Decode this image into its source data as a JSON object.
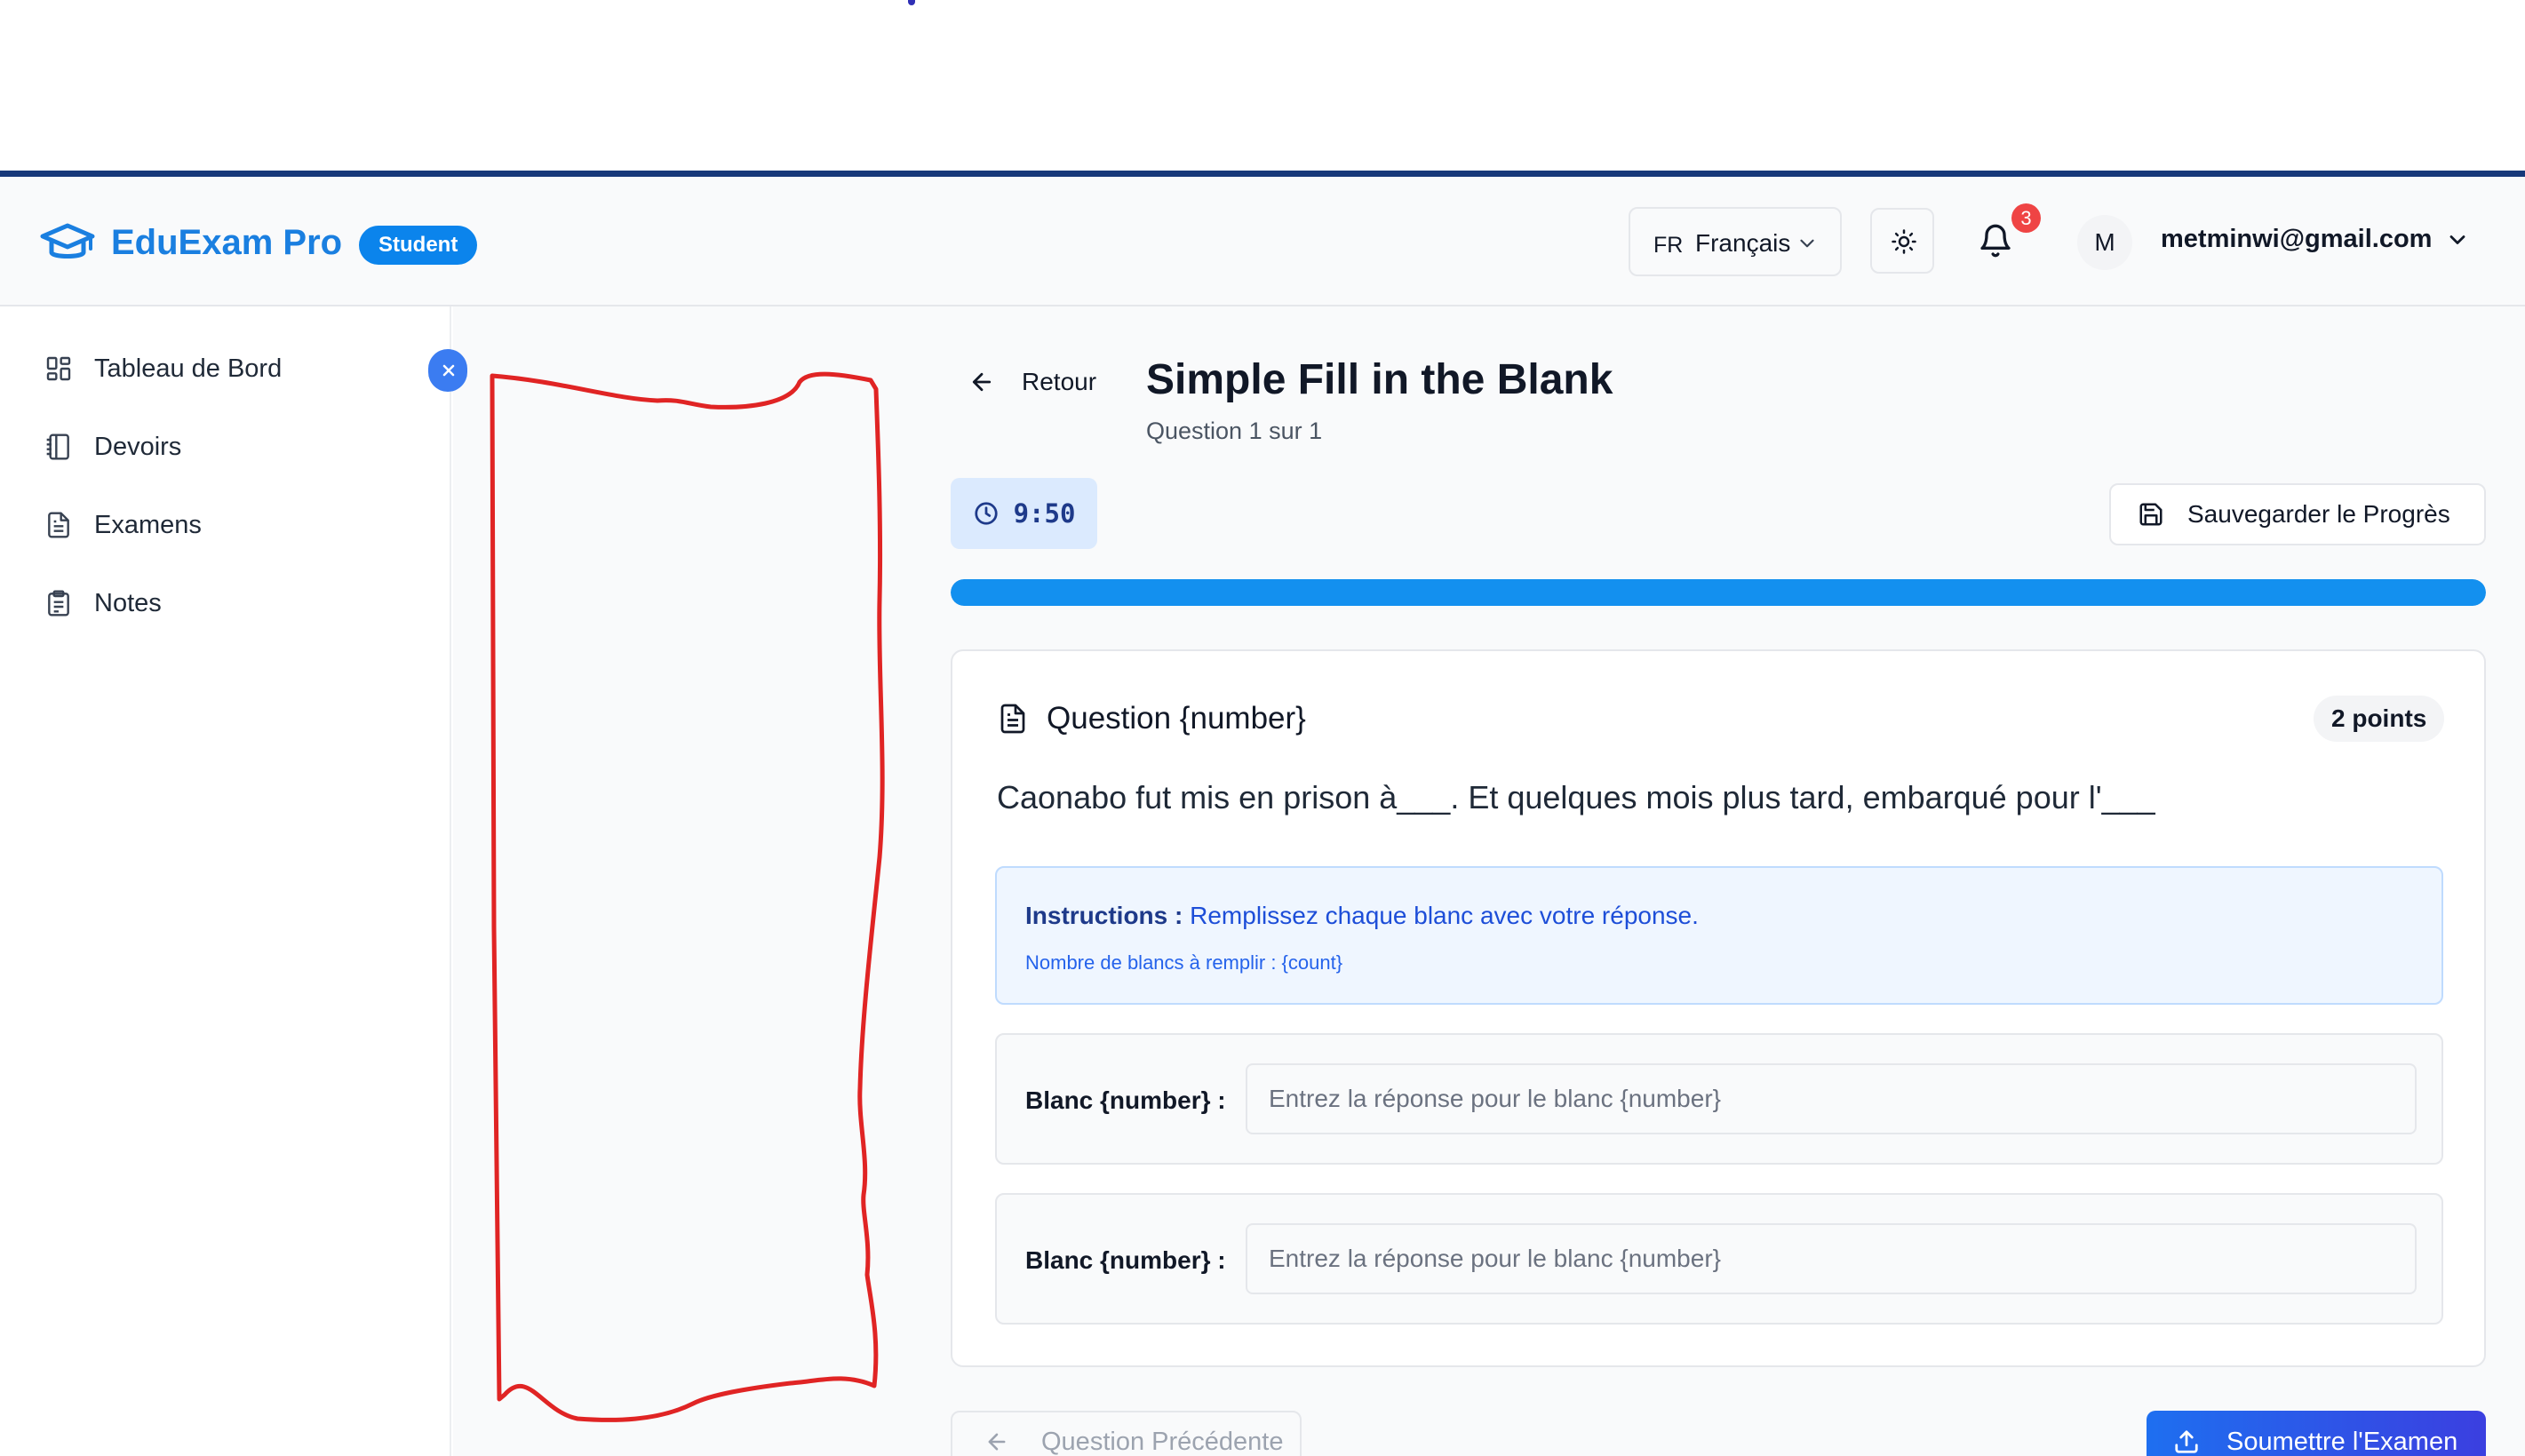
{
  "app": {
    "name": "EduExam Pro",
    "role_badge": "Student"
  },
  "header": {
    "language_code": "FR",
    "language_name": "Français",
    "notification_count": "3",
    "avatar_initial": "M",
    "user_email": "metminwi@gmail.com"
  },
  "sidebar": {
    "items": [
      {
        "label": "Tableau de Bord",
        "icon": "dashboard-icon"
      },
      {
        "label": "Devoirs",
        "icon": "notebook-icon"
      },
      {
        "label": "Examens",
        "icon": "document-icon"
      },
      {
        "label": "Notes",
        "icon": "clipboard-icon"
      }
    ]
  },
  "exam": {
    "back_label": "Retour",
    "title": "Simple Fill in the Blank",
    "subtitle": "Question 1 sur 1",
    "timer": "9:50",
    "save_label": "Sauvegarder le Progrès",
    "progress": 1.0
  },
  "question": {
    "heading": "Question {number}",
    "points": "2 points",
    "text": "Caonabo fut mis en prison à___. Et quelques mois plus tard, embarqué pour l'___",
    "instructions_label": "Instructions :",
    "instructions_text": "Remplissez chaque blanc avec votre réponse.",
    "blank_count_text": "Nombre de blancs à remplir : {count}",
    "blanks": [
      {
        "label": "Blanc {number} :",
        "placeholder": "Entrez la réponse pour le blanc {number}",
        "value": ""
      },
      {
        "label": "Blanc {number} :",
        "placeholder": "Entrez la réponse pour le blanc {number}",
        "value": ""
      }
    ]
  },
  "footer": {
    "prev_label": "Question Précédente",
    "submit_label": "Soumettre l'Examen"
  },
  "colors": {
    "brand": "#1a7fe0",
    "accent": "#1390ef",
    "annotation": "#e02424"
  }
}
